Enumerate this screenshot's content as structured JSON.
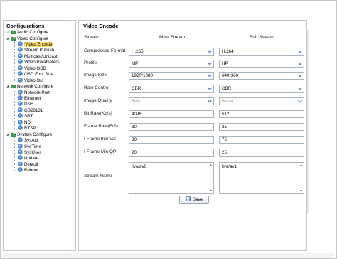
{
  "sidebar": {
    "title": "Configurations",
    "items": [
      {
        "label": "Audio Configure",
        "kind": "folder",
        "expander": "+"
      },
      {
        "label": "Video Configure",
        "kind": "folder",
        "expander": "-"
      },
      {
        "label": "Video Encode",
        "kind": "leaf",
        "selected": true
      },
      {
        "label": "Stream Publish",
        "kind": "leaf"
      },
      {
        "label": "Multicast/Unicast",
        "kind": "leaf"
      },
      {
        "label": "Video Parameters",
        "kind": "leaf"
      },
      {
        "label": "Video OSD",
        "kind": "leaf"
      },
      {
        "label": "OSD Font Size",
        "kind": "leaf"
      },
      {
        "label": "Video Out",
        "kind": "leaf"
      },
      {
        "label": "Network Configure",
        "kind": "folder",
        "expander": "-"
      },
      {
        "label": "Network Port",
        "kind": "leaf"
      },
      {
        "label": "Ethernet",
        "kind": "leaf"
      },
      {
        "label": "DNS",
        "kind": "leaf"
      },
      {
        "label": "GB28181",
        "kind": "leaf"
      },
      {
        "label": "SRT",
        "kind": "leaf"
      },
      {
        "label": "NDI",
        "kind": "leaf"
      },
      {
        "label": "RTSP",
        "kind": "leaf"
      },
      {
        "label": "System Configure",
        "kind": "folder",
        "expander": "-"
      },
      {
        "label": "SysAttr",
        "kind": "leaf"
      },
      {
        "label": "SysTime",
        "kind": "leaf"
      },
      {
        "label": "SysUser",
        "kind": "leaf"
      },
      {
        "label": "Update",
        "kind": "leaf"
      },
      {
        "label": "Default",
        "kind": "leaf"
      },
      {
        "label": "Reboot",
        "kind": "leaf"
      }
    ]
  },
  "main": {
    "title": "Video Encode",
    "headers": {
      "stream": "Stream",
      "main": "Main Stream",
      "sub": "Sub Stream"
    },
    "rows": [
      {
        "label": "Compressed Format",
        "type": "select",
        "main": "H.265",
        "sub": "H.264"
      },
      {
        "label": "Profile",
        "type": "select",
        "main": "MP",
        "sub": "HP"
      },
      {
        "label": "Image Size",
        "type": "select",
        "main": "1920*1080",
        "sub": "640*360"
      },
      {
        "label": "Rate Control",
        "type": "select",
        "main": "CBR",
        "sub": "CBR"
      },
      {
        "label": "Image Quality",
        "type": "select-disabled",
        "main": "Best",
        "sub": "Better"
      },
      {
        "label": "Bit Rate(Kb/s)",
        "type": "text",
        "main": "4096",
        "sub": "512"
      },
      {
        "label": "Frame Rate(F/S)",
        "type": "text",
        "main": "30",
        "sub": "25"
      },
      {
        "label": "I Frame Interval",
        "type": "text",
        "main": "30",
        "sub": "75"
      },
      {
        "label": "I Frame Min QP",
        "type": "text",
        "main": "20",
        "sub": "25"
      },
      {
        "label": "Stream Name",
        "type": "textarea",
        "main": "live/av0",
        "sub": "live/av1"
      }
    ],
    "save_label": "Save"
  },
  "colors": {
    "selected_highlight": "#f7dc6f",
    "border": "#a9b3bf",
    "folder": "#3fa34d"
  }
}
